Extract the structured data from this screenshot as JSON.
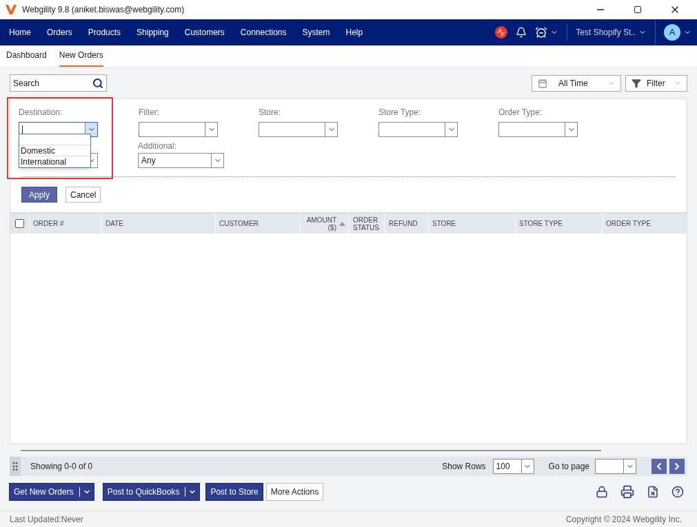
{
  "window": {
    "title": "Webgility 9.8 (aniket.biswas@webgility.com)"
  },
  "nav": {
    "items": [
      "Home",
      "Orders",
      "Products",
      "Shipping",
      "Customers",
      "Connections",
      "System",
      "Help"
    ],
    "store": "Test Shopify St..",
    "avatar": "A"
  },
  "tabs": [
    {
      "label": "Dashboard",
      "selected": false
    },
    {
      "label": "New Orders",
      "selected": true
    }
  ],
  "search": {
    "placeholder": "Search"
  },
  "date_range": "All Time",
  "filter_button": "Filter",
  "filters": [
    {
      "label": "Destination:",
      "focused": true
    },
    {
      "label": "Filter:",
      "focused": false
    },
    {
      "label": "Store:",
      "focused": false
    },
    {
      "label": "Store Type:",
      "focused": false
    },
    {
      "label": "Order Type:",
      "focused": false
    }
  ],
  "second_row": [
    {
      "kind": "select"
    },
    {
      "kind": "select",
      "label": "Additional:",
      "value": "Any"
    }
  ],
  "dropdown": {
    "options": [
      "Domestic",
      "International"
    ]
  },
  "actions": [
    "Apply",
    "Cancel"
  ],
  "table": {
    "select_all_checked": false,
    "columns": [
      {
        "label": "ORDER #",
        "sorted": false
      },
      {
        "label": "DATE",
        "sorted": false
      },
      {
        "label": "CUSTOMER",
        "sorted": false
      },
      {
        "label": "AMOUNT ($)",
        "sorted": true
      },
      {
        "label": "ORDER STATUS",
        "sorted": false
      },
      {
        "label": "REFUND",
        "sorted": false
      },
      {
        "label": "STORE",
        "sorted": false
      },
      {
        "label": "STORE TYPE",
        "sorted": false
      },
      {
        "label": "ORDER TYPE",
        "sorted": false
      }
    ]
  },
  "pager": {
    "showing": "Showing 0-0 of 0",
    "show_rows_label": "Show Rows",
    "show_rows": "100",
    "goto_label": "Go to page"
  },
  "buttons": [
    {
      "label": "Get New Orders",
      "kind": "split"
    },
    {
      "label": "Post to QuickBooks",
      "kind": "split"
    },
    {
      "label": "Post to Store",
      "kind": "primary"
    },
    {
      "label": "More Actions",
      "kind": "secondary"
    }
  ],
  "status": {
    "left": "Last Updated:Never",
    "right": "Copyright © 2024 Webgility Inc."
  }
}
